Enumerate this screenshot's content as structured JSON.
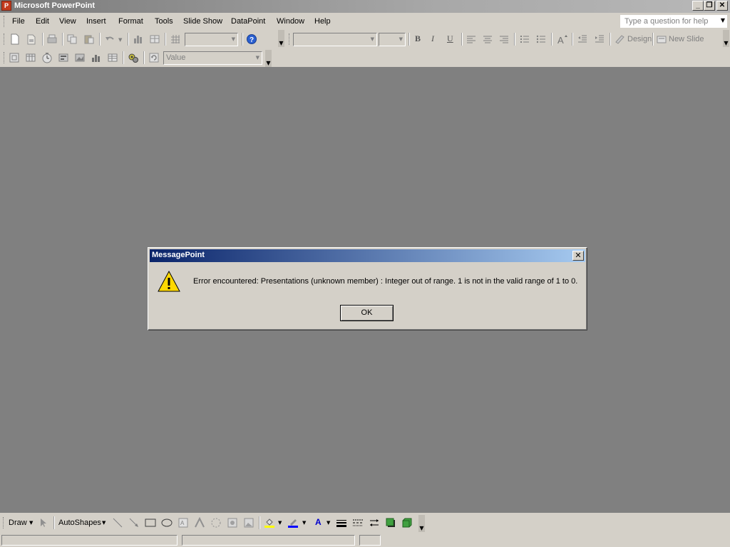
{
  "window": {
    "title": "Microsoft PowerPoint",
    "minimize": "_",
    "restore": "❐",
    "close": "✕"
  },
  "menu": {
    "items": [
      "File",
      "Edit",
      "View",
      "Insert",
      "Format",
      "Tools",
      "Slide Show",
      "DataPoint",
      "Window",
      "Help"
    ],
    "help_placeholder": "Type a question for help"
  },
  "standard_toolbar": {
    "zoom_value": "",
    "icons": [
      "new-icon",
      "open-icon",
      "print-icon",
      "copy-icon",
      "paste-icon",
      "undo-icon",
      "insert-chart-icon",
      "insert-table-icon",
      "show-grid-icon",
      "help-icon"
    ]
  },
  "formatting_toolbar": {
    "font_value": "",
    "size_value": "",
    "bold": "B",
    "italic": "I",
    "underline": "U",
    "design_label": "Design",
    "new_slide_label": "New Slide"
  },
  "datapoint_toolbar": {
    "value_combo": "Value"
  },
  "dialog": {
    "title": "MessagePoint",
    "message": "Error encountered: Presentations (unknown member) : Integer out of range. 1 is not in the valid range of 1 to 0.",
    "ok_label": "OK",
    "close": "✕"
  },
  "drawing_toolbar": {
    "draw_label": "Draw",
    "autoshapes_label": "AutoShapes"
  },
  "colors": {
    "workspace": "#808080",
    "chrome": "#d4d0c8",
    "dialog_title_start": "#0a246a",
    "dialog_title_end": "#a6caf0"
  }
}
